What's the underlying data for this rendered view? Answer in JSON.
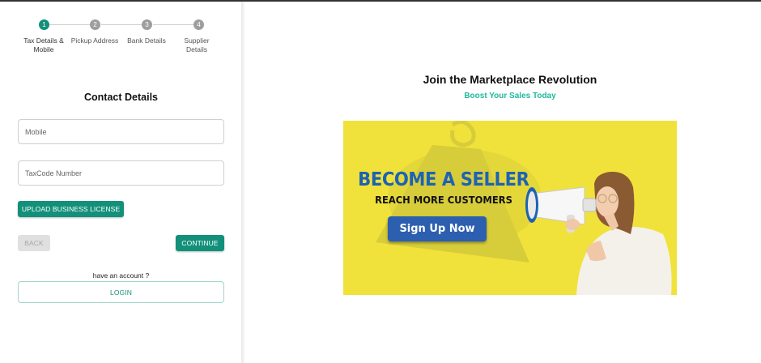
{
  "stepper": {
    "steps": [
      {
        "number": "1",
        "label": "Tax Details & Mobile",
        "active": true
      },
      {
        "number": "2",
        "label": "Pickup Address",
        "active": false
      },
      {
        "number": "3",
        "label": "Bank Details",
        "active": false
      },
      {
        "number": "4",
        "label": "Supplier Details",
        "active": false
      }
    ]
  },
  "form": {
    "title": "Contact Details",
    "mobile": {
      "placeholder": "Mobile",
      "value": ""
    },
    "taxcode": {
      "placeholder": "TaxCode Number",
      "value": ""
    },
    "upload_label": "Upload Business License",
    "back_label": "Back",
    "continue_label": "Continue",
    "have_account_text": "have an account ?",
    "login_label": "Login"
  },
  "promo": {
    "title": "Join the Marketplace Revolution",
    "subtitle": "Boost Your Sales Today",
    "banner": {
      "headline": "BECOME A SELLER",
      "subheadline": "REACH MORE CUSTOMERS",
      "cta_label": "Sign Up Now"
    }
  },
  "colors": {
    "accent": "#13907a",
    "subtitle": "#1fb89e",
    "banner_background": "#f0e23a",
    "banner_blue": "#1d63b3"
  },
  "icons": [
    "megaphone-icon",
    "money-bag-icon"
  ]
}
